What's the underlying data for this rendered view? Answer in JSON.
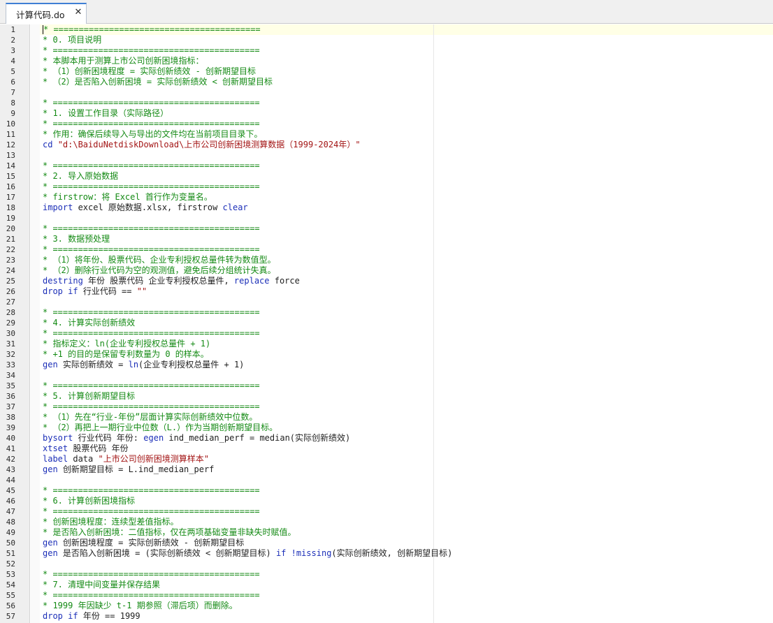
{
  "tab": {
    "title": "计算代码.do",
    "close_glyph": "✕"
  },
  "colors": {
    "comment": "#148a14",
    "keyword": "#1c2fb8",
    "string": "#a31515",
    "plain": "#1f1f1f"
  },
  "lines": [
    {
      "n": "1",
      "parts": [
        {
          "t": "c",
          "v": "* ========================================="
        }
      ]
    },
    {
      "n": "2",
      "parts": [
        {
          "t": "c",
          "v": "* 0. 项目说明"
        }
      ]
    },
    {
      "n": "3",
      "parts": [
        {
          "t": "c",
          "v": "* ========================================="
        }
      ]
    },
    {
      "n": "4",
      "parts": [
        {
          "t": "c",
          "v": "* 本脚本用于测算上市公司创新困境指标："
        }
      ]
    },
    {
      "n": "5",
      "parts": [
        {
          "t": "c",
          "v": "* （1）创新困境程度 = 实际创新绩效 - 创新期望目标"
        }
      ]
    },
    {
      "n": "6",
      "parts": [
        {
          "t": "c",
          "v": "* （2）是否陷入创新困境 = 实际创新绩效 < 创新期望目标"
        }
      ]
    },
    {
      "n": "7",
      "parts": []
    },
    {
      "n": "8",
      "parts": [
        {
          "t": "c",
          "v": "* ========================================="
        }
      ]
    },
    {
      "n": "9",
      "parts": [
        {
          "t": "c",
          "v": "* 1. 设置工作目录（实际路径）"
        }
      ]
    },
    {
      "n": "10",
      "parts": [
        {
          "t": "c",
          "v": "* ========================================="
        }
      ]
    },
    {
      "n": "11",
      "parts": [
        {
          "t": "c",
          "v": "* 作用：确保后续导入与导出的文件均在当前项目目录下。"
        }
      ]
    },
    {
      "n": "12",
      "parts": [
        {
          "t": "k",
          "v": "cd"
        },
        {
          "t": "p",
          "v": " "
        },
        {
          "t": "s",
          "v": "\"d:\\BaiduNetdiskDownload\\上市公司创新困境测算数据（1999-2024年）\""
        }
      ]
    },
    {
      "n": "13",
      "parts": []
    },
    {
      "n": "14",
      "parts": [
        {
          "t": "c",
          "v": "* ========================================="
        }
      ]
    },
    {
      "n": "15",
      "parts": [
        {
          "t": "c",
          "v": "* 2. 导入原始数据"
        }
      ]
    },
    {
      "n": "16",
      "parts": [
        {
          "t": "c",
          "v": "* ========================================="
        }
      ]
    },
    {
      "n": "17",
      "parts": [
        {
          "t": "c",
          "v": "* firstrow：将 Excel 首行作为变量名。"
        }
      ]
    },
    {
      "n": "18",
      "parts": [
        {
          "t": "k",
          "v": "import"
        },
        {
          "t": "p",
          "v": " excel 原始数据.xlsx, firstrow "
        },
        {
          "t": "k",
          "v": "clear"
        }
      ]
    },
    {
      "n": "19",
      "parts": []
    },
    {
      "n": "20",
      "parts": [
        {
          "t": "c",
          "v": "* ========================================="
        }
      ]
    },
    {
      "n": "21",
      "parts": [
        {
          "t": "c",
          "v": "* 3. 数据预处理"
        }
      ]
    },
    {
      "n": "22",
      "parts": [
        {
          "t": "c",
          "v": "* ========================================="
        }
      ]
    },
    {
      "n": "23",
      "parts": [
        {
          "t": "c",
          "v": "* （1）将年份、股票代码、企业专利授权总量件转为数值型。"
        }
      ]
    },
    {
      "n": "24",
      "parts": [
        {
          "t": "c",
          "v": "* （2）删除行业代码为空的观测值，避免后续分组统计失真。"
        }
      ]
    },
    {
      "n": "25",
      "parts": [
        {
          "t": "k",
          "v": "destring"
        },
        {
          "t": "p",
          "v": " 年份 股票代码 企业专利授权总量件, "
        },
        {
          "t": "k",
          "v": "replace"
        },
        {
          "t": "p",
          "v": " force"
        }
      ]
    },
    {
      "n": "26",
      "parts": [
        {
          "t": "k",
          "v": "drop"
        },
        {
          "t": "p",
          "v": " "
        },
        {
          "t": "k",
          "v": "if"
        },
        {
          "t": "p",
          "v": " 行业代码 == "
        },
        {
          "t": "s",
          "v": "\"\""
        }
      ]
    },
    {
      "n": "27",
      "parts": []
    },
    {
      "n": "28",
      "parts": [
        {
          "t": "c",
          "v": "* ========================================="
        }
      ]
    },
    {
      "n": "29",
      "parts": [
        {
          "t": "c",
          "v": "* 4. 计算实际创新绩效"
        }
      ]
    },
    {
      "n": "30",
      "parts": [
        {
          "t": "c",
          "v": "* ========================================="
        }
      ]
    },
    {
      "n": "31",
      "parts": [
        {
          "t": "c",
          "v": "* 指标定义：ln(企业专利授权总量件 + 1)"
        }
      ]
    },
    {
      "n": "32",
      "parts": [
        {
          "t": "c",
          "v": "* +1 的目的是保留专利数量为 0 的样本。"
        }
      ]
    },
    {
      "n": "33",
      "parts": [
        {
          "t": "k",
          "v": "gen"
        },
        {
          "t": "p",
          "v": " 实际创新绩效 = "
        },
        {
          "t": "k",
          "v": "ln"
        },
        {
          "t": "p",
          "v": "(企业专利授权总量件 + 1)"
        }
      ]
    },
    {
      "n": "34",
      "parts": []
    },
    {
      "n": "35",
      "parts": [
        {
          "t": "c",
          "v": "* ========================================="
        }
      ]
    },
    {
      "n": "36",
      "parts": [
        {
          "t": "c",
          "v": "* 5. 计算创新期望目标"
        }
      ]
    },
    {
      "n": "37",
      "parts": [
        {
          "t": "c",
          "v": "* ========================================="
        }
      ]
    },
    {
      "n": "38",
      "parts": [
        {
          "t": "c",
          "v": "* （1）先在“行业-年份”层面计算实际创新绩效中位数。"
        }
      ]
    },
    {
      "n": "39",
      "parts": [
        {
          "t": "c",
          "v": "* （2）再把上一期行业中位数（L.）作为当期创新期望目标。"
        }
      ]
    },
    {
      "n": "40",
      "parts": [
        {
          "t": "k",
          "v": "bysort"
        },
        {
          "t": "p",
          "v": " 行业代码 年份: "
        },
        {
          "t": "k",
          "v": "egen"
        },
        {
          "t": "p",
          "v": " ind_median_perf = median(实际创新绩效)"
        }
      ]
    },
    {
      "n": "41",
      "parts": [
        {
          "t": "k",
          "v": "xtset"
        },
        {
          "t": "p",
          "v": " 股票代码 年份"
        }
      ]
    },
    {
      "n": "42",
      "parts": [
        {
          "t": "k",
          "v": "label"
        },
        {
          "t": "p",
          "v": " data "
        },
        {
          "t": "s",
          "v": "\"上市公司创新困境测算样本\""
        }
      ]
    },
    {
      "n": "43",
      "parts": [
        {
          "t": "k",
          "v": "gen"
        },
        {
          "t": "p",
          "v": " 创新期望目标 = L.ind_median_perf"
        }
      ]
    },
    {
      "n": "44",
      "parts": []
    },
    {
      "n": "45",
      "parts": [
        {
          "t": "c",
          "v": "* ========================================="
        }
      ]
    },
    {
      "n": "46",
      "parts": [
        {
          "t": "c",
          "v": "* 6. 计算创新困境指标"
        }
      ]
    },
    {
      "n": "47",
      "parts": [
        {
          "t": "c",
          "v": "* ========================================="
        }
      ]
    },
    {
      "n": "48",
      "parts": [
        {
          "t": "c",
          "v": "* 创新困境程度：连续型差值指标。"
        }
      ]
    },
    {
      "n": "49",
      "parts": [
        {
          "t": "c",
          "v": "* 是否陷入创新困境：二值指标，仅在两项基础变量非缺失时赋值。"
        }
      ]
    },
    {
      "n": "50",
      "parts": [
        {
          "t": "k",
          "v": "gen"
        },
        {
          "t": "p",
          "v": " 创新困境程度 = 实际创新绩效 - 创新期望目标"
        }
      ]
    },
    {
      "n": "51",
      "parts": [
        {
          "t": "k",
          "v": "gen"
        },
        {
          "t": "p",
          "v": " 是否陷入创新困境 = (实际创新绩效 < 创新期望目标) "
        },
        {
          "t": "k",
          "v": "if"
        },
        {
          "t": "p",
          "v": " "
        },
        {
          "t": "k",
          "v": "!missing"
        },
        {
          "t": "p",
          "v": "(实际创新绩效, 创新期望目标)"
        }
      ]
    },
    {
      "n": "52",
      "parts": []
    },
    {
      "n": "53",
      "parts": [
        {
          "t": "c",
          "v": "* ========================================="
        }
      ]
    },
    {
      "n": "54",
      "parts": [
        {
          "t": "c",
          "v": "* 7. 清理中间变量并保存结果"
        }
      ]
    },
    {
      "n": "55",
      "parts": [
        {
          "t": "c",
          "v": "* ========================================="
        }
      ]
    },
    {
      "n": "56",
      "parts": [
        {
          "t": "c",
          "v": "* 1999 年因缺少 t-1 期参照（滞后项）而删除。"
        }
      ]
    },
    {
      "n": "57",
      "parts": [
        {
          "t": "k",
          "v": "drop"
        },
        {
          "t": "p",
          "v": " "
        },
        {
          "t": "k",
          "v": "if"
        },
        {
          "t": "p",
          "v": " 年份 == 1999"
        }
      ]
    }
  ]
}
